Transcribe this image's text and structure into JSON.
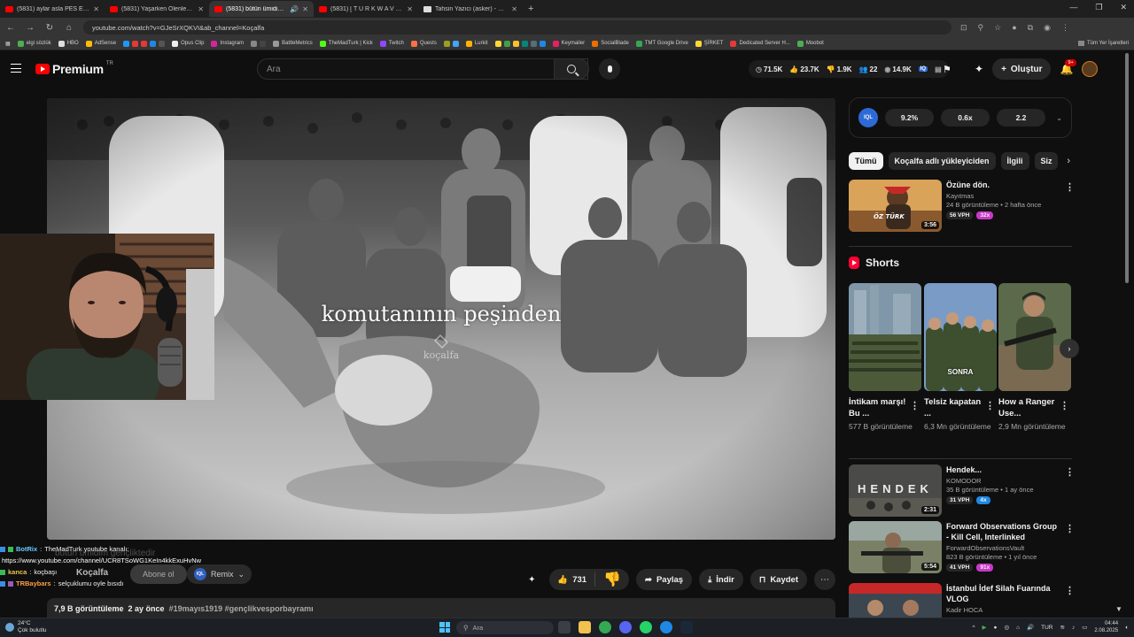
{
  "browser": {
    "tabs": [
      {
        "title": "(5831) aylar asla PES ETMEZ!",
        "icon": "youtube-icon",
        "active": false
      },
      {
        "title": "(5831) Yaşarken Ölenler İçin - Y",
        "icon": "youtube-icon",
        "active": false
      },
      {
        "title": "(5831) bütün ümidim genç",
        "icon": "youtube-icon",
        "active": true
      },
      {
        "title": "(5831) [ T U R K W A V E ] - 1",
        "icon": "youtube-icon",
        "active": false
      },
      {
        "title": "Tahsin Yazıcı (asker) - Vikipedi",
        "icon": "wikipedia-icon",
        "active": false
      }
    ],
    "url": "youtube.com/watch?v=GJeSrXQKVI&ab_channel=Koçalfa",
    "bookmarks": [
      "elgi sözlük",
      "HBO",
      "AdSense",
      "Opus Clip",
      "Instagram",
      "BattleMetrics",
      "TheMadTurk | Kick",
      "Twitch",
      "Quests",
      "Lurkit",
      "Keymailer",
      "SocialBlade",
      "TMT Google Drive",
      "ŞİRKET",
      "Dedicated Server H...",
      "Moobot"
    ],
    "bookmarks_right": "Tüm Yer İşaretleri"
  },
  "youtube": {
    "logo_text": "Premium",
    "logo_region": "TR",
    "search_placeholder": "Ara",
    "stats": [
      {
        "icon": "clock-icon",
        "value": "71.5K"
      },
      {
        "icon": "thumb-icon",
        "value": "23.7K"
      },
      {
        "icon": "dislike-icon",
        "value": "1.9K"
      },
      {
        "icon": "people-icon",
        "value": "22"
      },
      {
        "icon": "eye-icon",
        "value": "14.9K"
      }
    ],
    "create_label": "Oluştur",
    "notifications_badge": "9+"
  },
  "video": {
    "subtitle": "komutanının peşinden",
    "watermark": "koçalfa",
    "channel": "Koçalfa",
    "subscribe_label": "Abone ol",
    "remix_label": "Remix",
    "remix_badge": "IQL",
    "like_count": "731",
    "share_label": "Paylaş",
    "download_label": "İndir",
    "save_label": "Kaydet",
    "views": "7,9 B görüntüleme",
    "age": "2 ay önce",
    "hashtags": "#19mayıs1919 #gençlikvesporbayramı"
  },
  "chat": [
    {
      "user": "BotRix",
      "message": "TheMadTurk youtube kanalı:"
    },
    {
      "user": "",
      "message": "https://www.youtube.com/channel/UCR8TSoWG1KeIn4kkExuHvNw"
    },
    {
      "user": "kanca",
      "message": "koçbaşı"
    },
    {
      "user": "TRBaybars",
      "message": "selçuklumu oyle bısıdı"
    }
  ],
  "ghost_title": "bütün ümidim gençliktedir",
  "sidebar": {
    "iq_label": "IQL",
    "metrics": [
      "9.2%",
      "0.6x",
      "2.2"
    ],
    "chips": [
      "Tümü",
      "Koçalfa adlı yükleyiciden",
      "İlgili",
      "Siz"
    ],
    "related": [
      {
        "title": "Özüne dön.",
        "channel": "Kayıtmas",
        "meta": "24 B görüntüleme • 2 hafta önce",
        "duration": "3:56",
        "vph": "56 VPH",
        "mult": "32x",
        "mult_color": "#c838c8"
      },
      {
        "title": "Hendek...",
        "channel": "KOMODOR",
        "meta": "35 B görüntüleme • 1 ay önce",
        "duration": "2:31",
        "vph": "31 VPH",
        "mult": "4x",
        "mult_color": "#1e88e5"
      },
      {
        "title": "Forward Observations Group - Kill Cell, Interlinked",
        "channel": "ForwardObservationsVault",
        "meta": "823 B görüntüleme • 1 yıl önce",
        "duration": "5:54",
        "vph": "41 VPH",
        "mult": "91x",
        "mult_color": "#c838c8"
      },
      {
        "title": "İstanbul İdef Silah Fuarında VLOG",
        "channel": "Kadir HOCA",
        "meta": "",
        "duration": "",
        "vph": "",
        "mult": "",
        "mult_color": ""
      }
    ],
    "shorts_label": "Shorts",
    "shorts": [
      {
        "title": "İntikam marşı! Bu ...",
        "views": "577 B görüntüleme",
        "overlay": ""
      },
      {
        "title": "Telsiz kapatan ...",
        "views": "6,3 Mn görüntüleme",
        "overlay": "SONRA"
      },
      {
        "title": "How a Ranger Use...",
        "views": "2,9 Mn görüntüleme",
        "overlay": ""
      }
    ],
    "hendek_thumb_text": "HENDEK"
  },
  "taskbar": {
    "temp": "24°C",
    "weather": "Çok bulutlu",
    "search_placeholder": "Ara",
    "lang": "TUR",
    "time": "04:44",
    "date": "2.08.2025"
  }
}
